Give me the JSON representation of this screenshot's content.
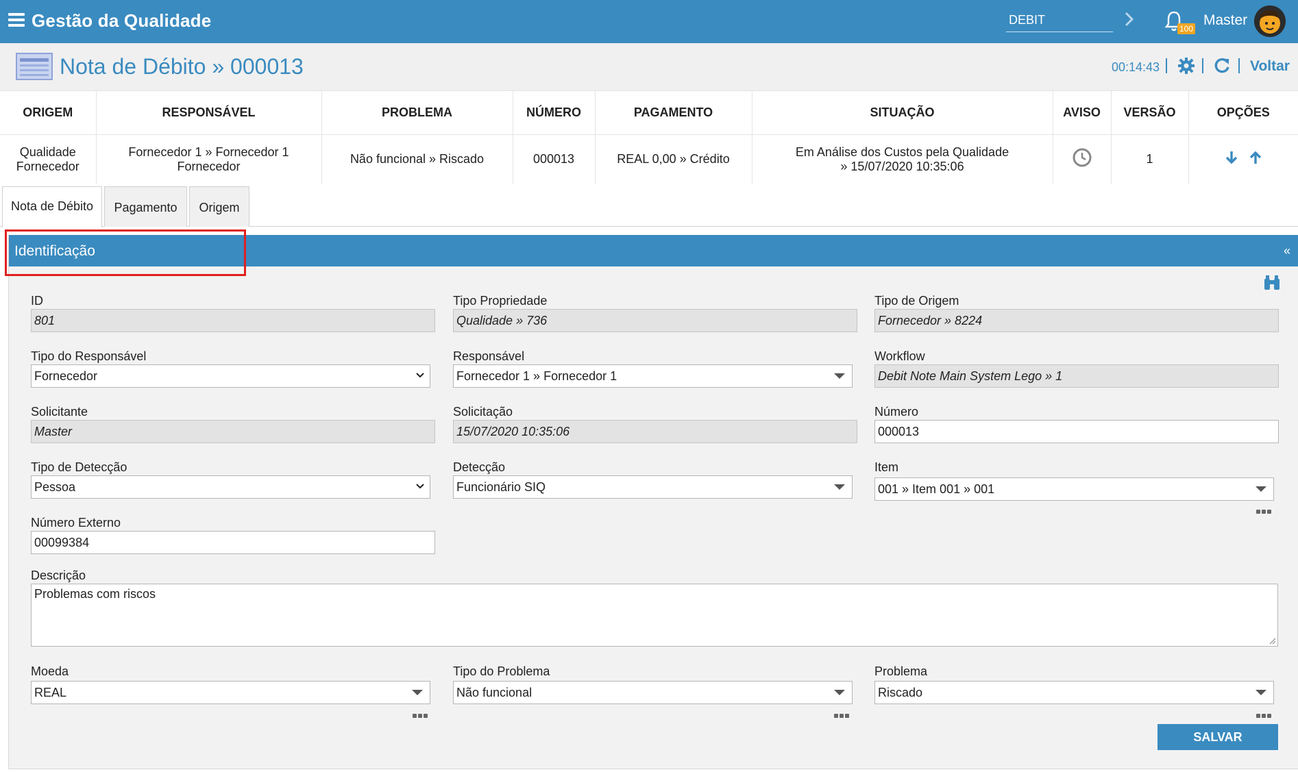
{
  "topbar": {
    "app_title": "Gestão da Qualidade",
    "module_value": "DEBIT",
    "notification_count": "100",
    "user_name": "Master"
  },
  "header": {
    "page_title": "Nota de Débito » 000013",
    "timer": "00:14:43",
    "back_label": "Voltar"
  },
  "summary": {
    "columns": [
      "ORIGEM",
      "RESPONSÁVEL",
      "PROBLEMA",
      "NÚMERO",
      "PAGAMENTO",
      "SITUAÇÃO",
      "AVISO",
      "VERSÃO",
      "OPÇÕES"
    ],
    "row": {
      "origem_1": "Qualidade",
      "origem_2": "Fornecedor",
      "responsavel_1": "Fornecedor 1 » Fornecedor 1",
      "responsavel_2": "Fornecedor",
      "problema": "Não funcional » Riscado",
      "numero": "000013",
      "pagamento": "REAL 0,00 » Crédito",
      "situacao_1": "Em Análise dos Custos pela Qualidade",
      "situacao_2": "» 15/07/2020 10:35:06",
      "aviso_icon": "clock-icon",
      "versao": "1",
      "opcoes_icons": [
        "arrow-down-icon",
        "arrow-up-icon"
      ]
    }
  },
  "tabs": [
    {
      "label": "Nota de Débito",
      "active": true
    },
    {
      "label": "Pagamento",
      "active": false
    },
    {
      "label": "Origem",
      "active": false
    }
  ],
  "panel": {
    "title": "Identificação",
    "collapse_label": "«"
  },
  "form": {
    "id": {
      "label": "ID",
      "value": "801"
    },
    "tipo_propriedade": {
      "label": "Tipo Propriedade",
      "value": "Qualidade » 736"
    },
    "tipo_origem": {
      "label": "Tipo de Origem",
      "value": "Fornecedor » 8224"
    },
    "tipo_responsavel": {
      "label": "Tipo do Responsável",
      "value": "Fornecedor"
    },
    "responsavel": {
      "label": "Responsável",
      "value": "Fornecedor 1 » Fornecedor 1"
    },
    "workflow": {
      "label": "Workflow",
      "value": "Debit Note Main System Lego » 1"
    },
    "solicitante": {
      "label": "Solicitante",
      "value": "Master"
    },
    "solicitacao": {
      "label": "Solicitação",
      "value": "15/07/2020 10:35:06"
    },
    "numero": {
      "label": "Número",
      "value": "000013"
    },
    "tipo_deteccao": {
      "label": "Tipo de Detecção",
      "value": "Pessoa"
    },
    "deteccao": {
      "label": "Detecção",
      "value": "Funcionário SIQ"
    },
    "item": {
      "label": "Item",
      "value": "001 » Item 001 » 001"
    },
    "numero_externo": {
      "label": "Número Externo",
      "value": "00099384"
    },
    "descricao": {
      "label": "Descrição",
      "value": "Problemas com riscos"
    },
    "moeda": {
      "label": "Moeda",
      "value": "REAL"
    },
    "tipo_problema": {
      "label": "Tipo do Problema",
      "value": "Não funcional"
    },
    "problema": {
      "label": "Problema",
      "value": "Riscado"
    },
    "save_label": "SALVAR"
  },
  "colors": {
    "brand": "#3a8bc0",
    "badge": "#f0a623",
    "highlight": "#e02020"
  }
}
